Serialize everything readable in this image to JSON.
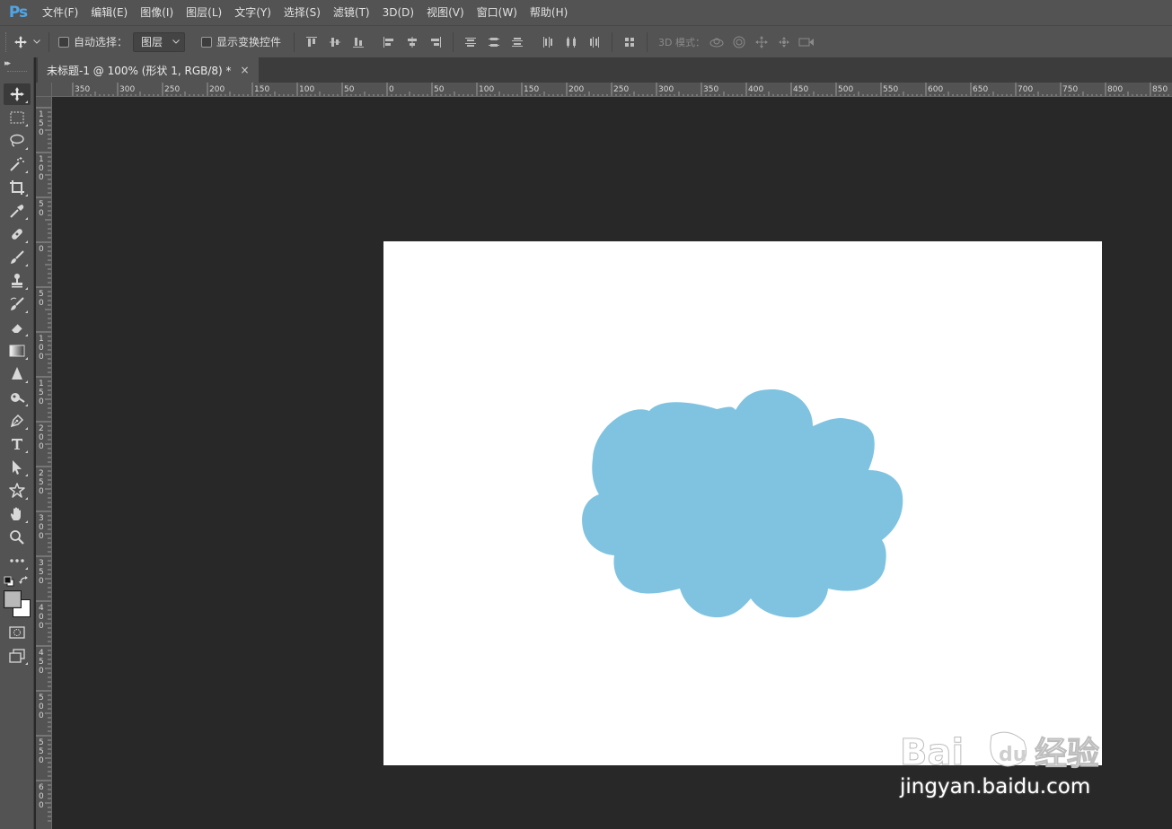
{
  "app": {
    "logo": "Ps"
  },
  "menu": {
    "items": [
      "文件(F)",
      "编辑(E)",
      "图像(I)",
      "图层(L)",
      "文字(Y)",
      "选择(S)",
      "滤镜(T)",
      "3D(D)",
      "视图(V)",
      "窗口(W)",
      "帮助(H)"
    ]
  },
  "options": {
    "auto_select_label": "自动选择：",
    "auto_select_checked": false,
    "target_value": "图层",
    "show_transform_label": "显示变换控件",
    "show_transform_checked": false,
    "mode3d_label": "3D 模式："
  },
  "document": {
    "tab_title": "未标题-1 @ 100% (形状 1, RGB/8) *",
    "close_glyph": "×",
    "canvas_bg": "#ffffff",
    "shape_color": "#7fc3e1"
  },
  "rulers": {
    "horizontal_labels": [
      "350",
      "300",
      "250",
      "200",
      "150",
      "100",
      "50",
      "0",
      "50",
      "100",
      "150",
      "200",
      "250",
      "300",
      "350",
      "400",
      "450",
      "500",
      "550",
      "600",
      "650",
      "700",
      "750",
      "800",
      "850"
    ],
    "vertical_labels": [
      "150",
      "100",
      "50",
      "0",
      "50",
      "100",
      "150",
      "200",
      "250",
      "300",
      "350",
      "400",
      "450",
      "500",
      "550",
      "600"
    ]
  },
  "toolbar": {
    "tools": [
      "move-tool",
      "marquee-tool",
      "lasso-tool",
      "magic-wand-tool",
      "crop-tool",
      "eyedropper-tool",
      "healing-brush-tool",
      "brush-tool",
      "clone-stamp-tool",
      "history-brush-tool",
      "eraser-tool",
      "gradient-tool",
      "blur-tool",
      "dodge-tool",
      "pen-tool",
      "type-tool",
      "path-selection-tool",
      "custom-shape-tool",
      "hand-tool",
      "zoom-tool",
      "edit-toolbar",
      "default-colors",
      "swap-colors",
      "foreground-color",
      "background-color",
      "quick-mask",
      "screen-mode"
    ],
    "foreground_color": "#b9b9b9",
    "background_color": "#ffffff"
  },
  "watermark": {
    "brand": "Baidu经验",
    "url": "jingyan.baidu.com"
  }
}
